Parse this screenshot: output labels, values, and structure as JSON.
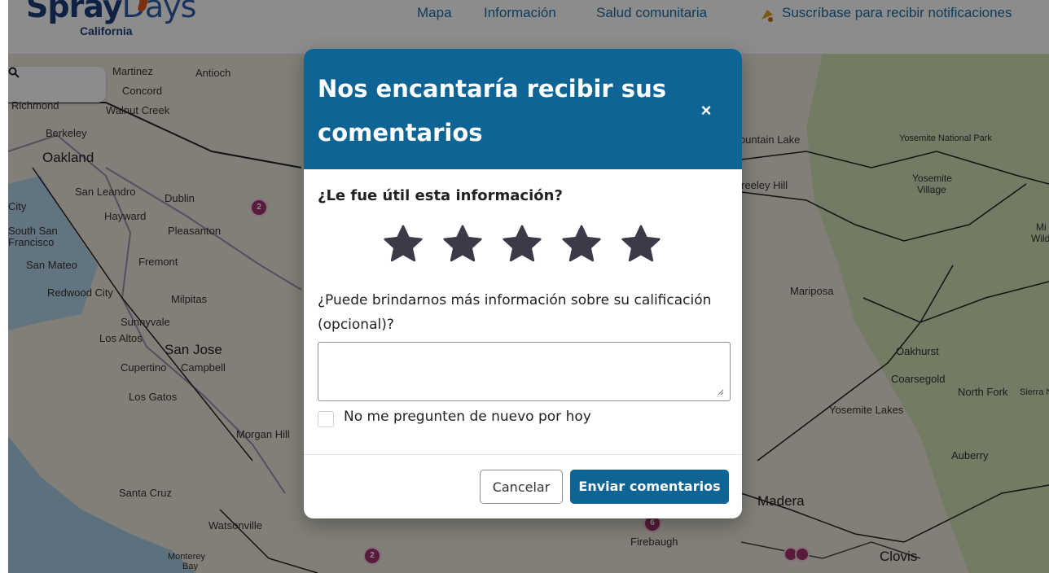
{
  "header": {
    "logo_main": "Spray",
    "logo_light": "Days",
    "logo_sub": "California",
    "nav": [
      "Mapa",
      "Información",
      "Salud comunitaria",
      "Suscríbase para recibir notificaciones"
    ],
    "bell_icon": "bell-icon"
  },
  "map": {
    "labels_left": [
      "Martinez",
      "Antioch",
      "Concord",
      "Richmond",
      "Walnut Creek",
      "Berkeley",
      "Oakland",
      "San Leandro",
      "Dublin",
      "City",
      "Hayward",
      "South San",
      "Francisco",
      "Pleasanton",
      "San Mateo",
      "Fremont",
      "Redwood City",
      "Milpitas",
      "Sunnyvale",
      "Los Altos",
      "San Jose",
      "Cupertino",
      "Campbell",
      "Los Gatos",
      "Morgan Hill",
      "Santa Cruz",
      "Watsonville",
      "Monterey",
      "Bay"
    ],
    "labels_right": [
      "Fountain Lake",
      "Yosemite National Park",
      "Yosemite",
      "Village",
      "Greeley Hill",
      "Mariposa",
      "Oakhurst",
      "Coarsegold",
      "North Fork",
      "Sierra Na",
      "Yosemite Lakes",
      "Auberry",
      "Madera",
      "Firebaugh",
      "Clovis",
      "Mi",
      "Wild"
    ],
    "markers": [
      "2",
      "2",
      "6"
    ]
  },
  "modal": {
    "title": "Nos encantaría recibir sus comentarios",
    "close_label": "×",
    "question_rating": "¿Le fue útil esta información?",
    "stars_count": 5,
    "selected_rating": 0,
    "question_details": "¿Puede brindarnos más información sobre su calificación (opcional)?",
    "textarea_value": "",
    "dont_ask_label": "No me pregunten de nuevo por hoy",
    "dont_ask_checked": false,
    "cancel_label": "Cancelar",
    "submit_label": "Enviar comentarios",
    "colors": {
      "primary": "#0f6496",
      "star": "#3b3a48"
    }
  }
}
